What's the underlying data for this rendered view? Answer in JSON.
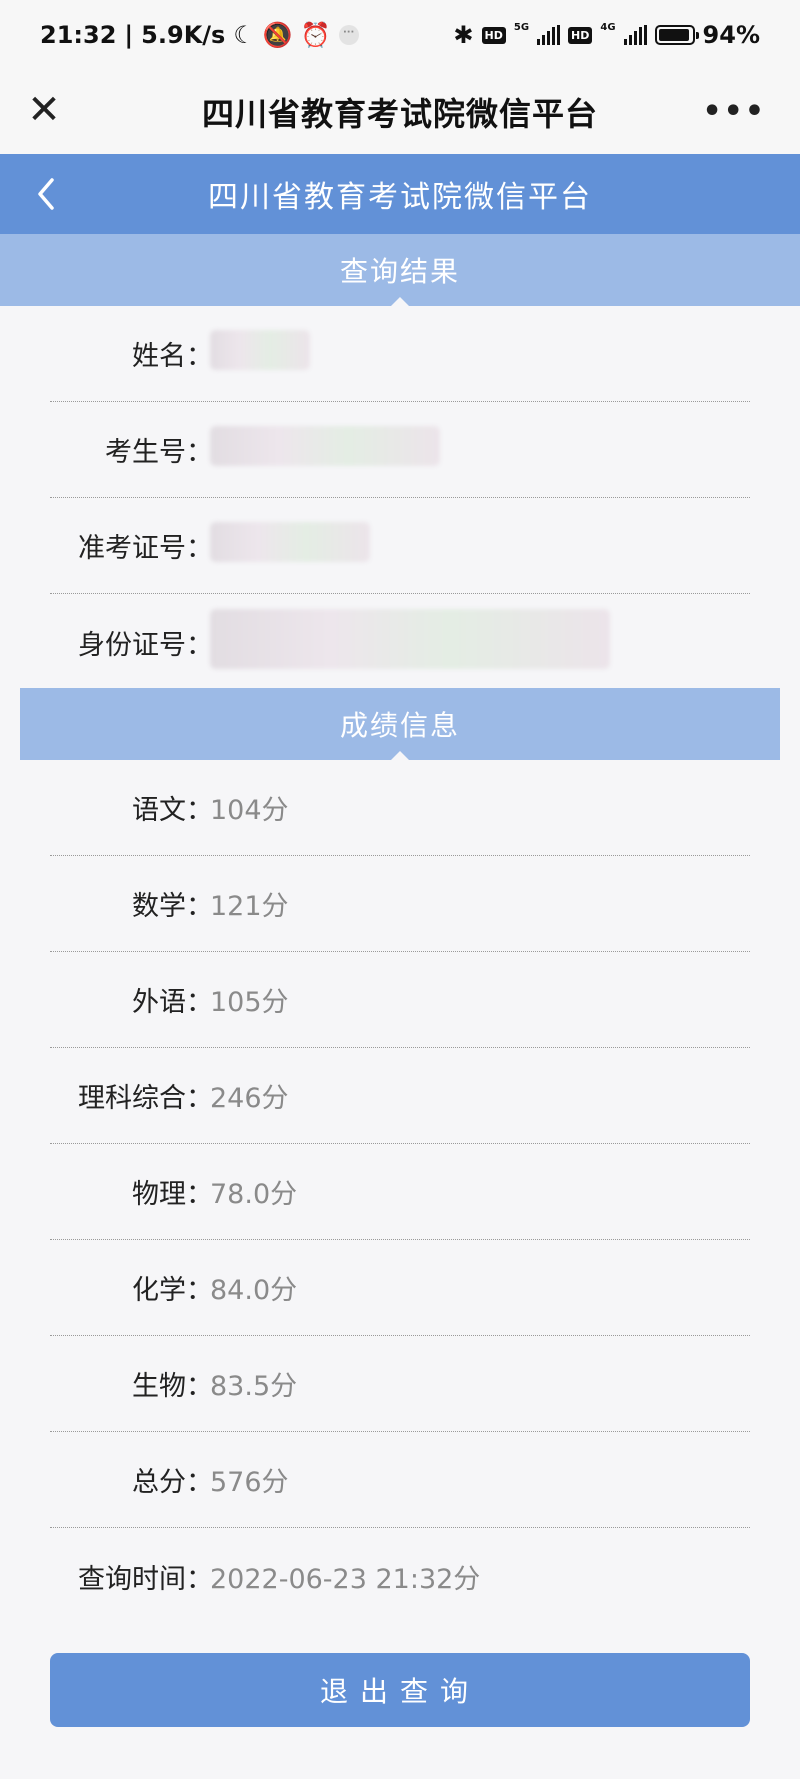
{
  "status_bar": {
    "time": "21:32",
    "speed": "5.9K/s",
    "net1": "5G",
    "net2": "4G",
    "hd": "HD",
    "battery_percent": 94,
    "battery_text": "94%"
  },
  "wechat_nav": {
    "title": "四川省教育考试院微信平台",
    "close_icon": "close-icon",
    "more_icon": "more-icon"
  },
  "header": {
    "title": "四川省教育考试院微信平台",
    "back_icon": "chevron-left-icon"
  },
  "query_section": {
    "title": "查询结果",
    "fields": [
      {
        "label": "姓名",
        "value": ""
      },
      {
        "label": "考生号",
        "value": ""
      },
      {
        "label": "准考证号",
        "value": ""
      },
      {
        "label": "身份证号",
        "value": ""
      }
    ]
  },
  "score_section": {
    "title": "成绩信息",
    "rows": [
      {
        "label": "语文",
        "value": "104分"
      },
      {
        "label": "数学",
        "value": "121分"
      },
      {
        "label": "外语",
        "value": "105分"
      },
      {
        "label": "理科综合",
        "value": "246分"
      },
      {
        "label": "物理",
        "value": "78.0分"
      },
      {
        "label": "化学",
        "value": "84.0分"
      },
      {
        "label": "生物",
        "value": "83.5分"
      },
      {
        "label": "总分",
        "value": "576分"
      },
      {
        "label": "查询时间",
        "value": "2022-06-23 21:32分"
      }
    ]
  },
  "colon": "：",
  "exit_button": {
    "label": "退出查询"
  },
  "colors": {
    "primary": "#6291d7",
    "section": "#9cbae6",
    "background": "#f6f6f8"
  }
}
